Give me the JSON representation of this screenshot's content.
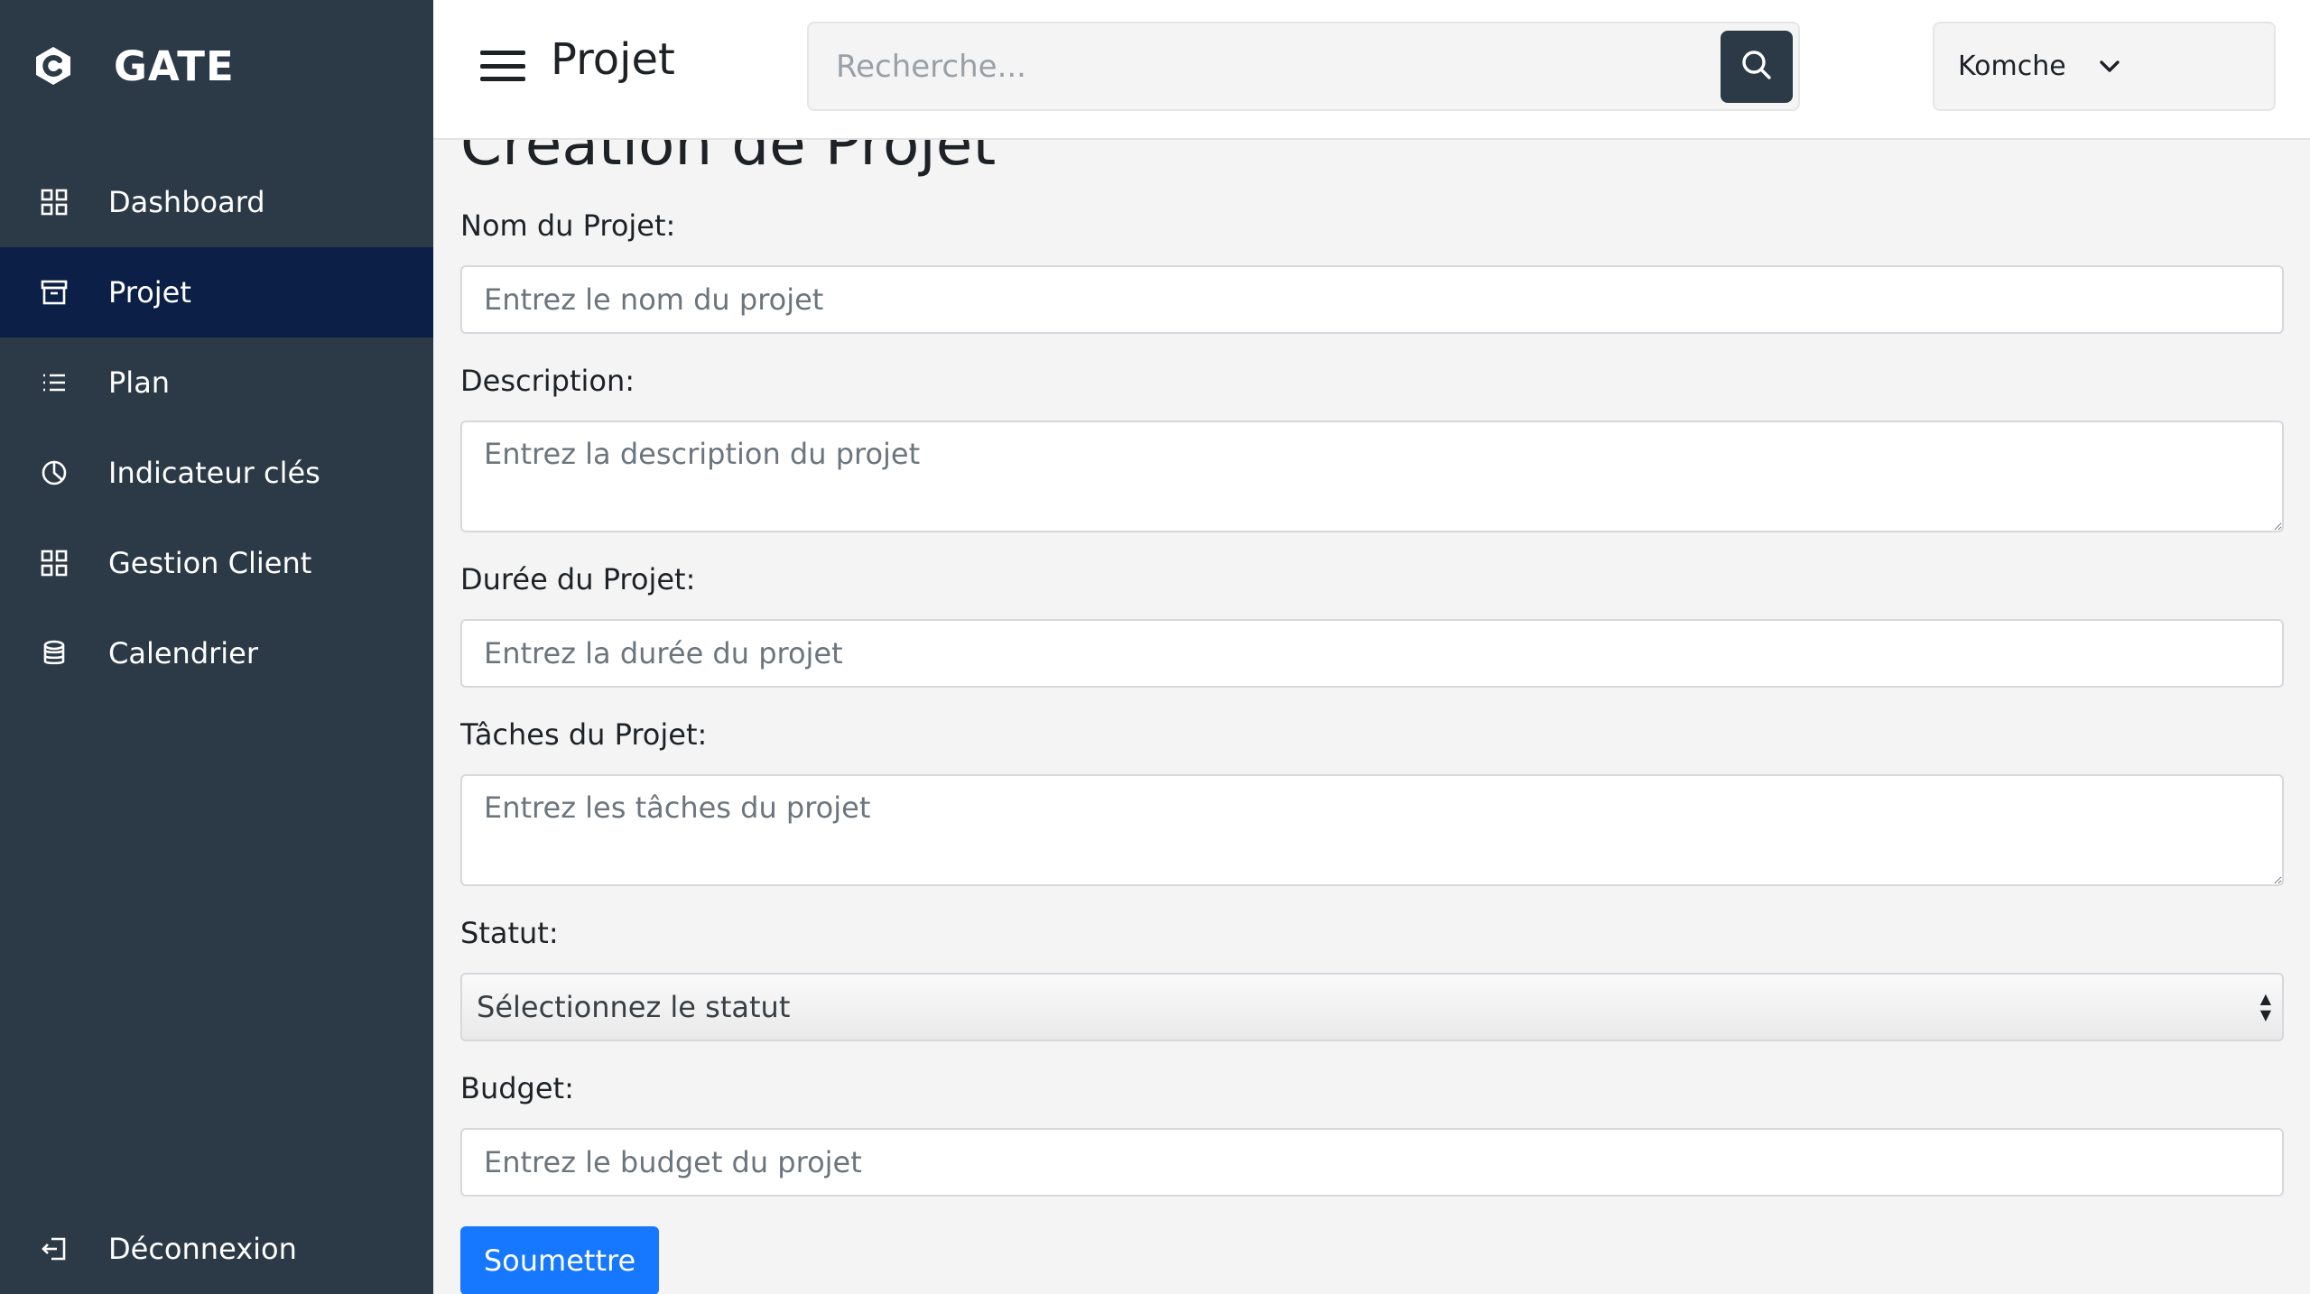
{
  "app": {
    "name": "GATE",
    "logo_icon": "gate-logo-icon"
  },
  "sidebar": {
    "items": [
      {
        "label": "Dashboard",
        "icon": "grid-icon",
        "active": false
      },
      {
        "label": "Projet",
        "icon": "archive-icon",
        "active": true
      },
      {
        "label": "Plan",
        "icon": "list-icon",
        "active": false
      },
      {
        "label": "Indicateur clés",
        "icon": "pie-chart-icon",
        "active": false
      },
      {
        "label": "Gestion Client",
        "icon": "grid-icon",
        "active": false
      },
      {
        "label": "Calendrier",
        "icon": "database-icon",
        "active": false
      }
    ],
    "logout": {
      "label": "Déconnexion",
      "icon": "logout-icon"
    }
  },
  "topbar": {
    "title": "Projet",
    "search_placeholder": "Recherche...",
    "user_name": "Komche"
  },
  "form": {
    "title": "Création de Projet",
    "name_label": "Nom du Projet:",
    "name_placeholder": "Entrez le nom du projet",
    "description_label": "Description:",
    "description_placeholder": "Entrez la description du projet",
    "duration_label": "Durée du Projet:",
    "duration_placeholder": "Entrez la durée du projet",
    "tasks_label": "Tâches du Projet:",
    "tasks_placeholder": "Entrez les tâches du projet",
    "status_label": "Statut:",
    "status_value": "Sélectionnez le statut",
    "budget_label": "Budget:",
    "budget_placeholder": "Entrez le budget du projet",
    "submit_label": "Soumettre"
  },
  "colors": {
    "sidebar_bg": "#2c3a47",
    "sidebar_active": "#0c1f47",
    "primary_button": "#1677ff"
  }
}
